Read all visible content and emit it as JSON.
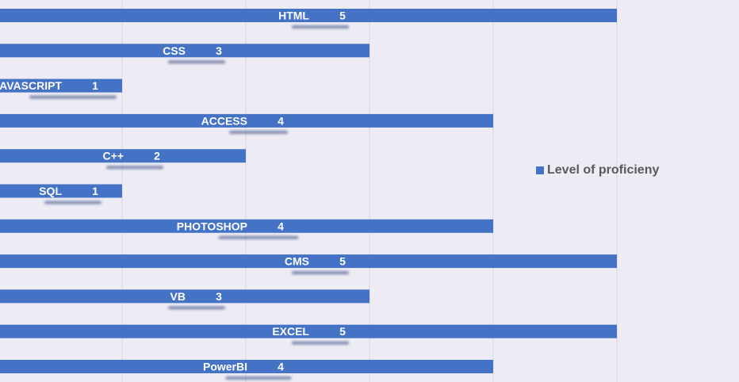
{
  "chart_data": {
    "type": "bar",
    "orientation": "horizontal",
    "categories": [
      "HTML",
      "CSS",
      "JAVASCRIPT",
      "ACCESS",
      "C++",
      "SQL",
      "PHOTOSHOP",
      "CMS",
      "VB",
      "EXCEL",
      "PowerBI"
    ],
    "series": [
      {
        "name": "Level of proficieny",
        "values": [
          5,
          3,
          1,
          4,
          2,
          1,
          4,
          5,
          3,
          5,
          4
        ],
        "color": "#4472c4"
      }
    ],
    "xlim": [
      0,
      5
    ],
    "grid": true,
    "data_labels": "category and value inside bar",
    "legend_position": "right"
  }
}
